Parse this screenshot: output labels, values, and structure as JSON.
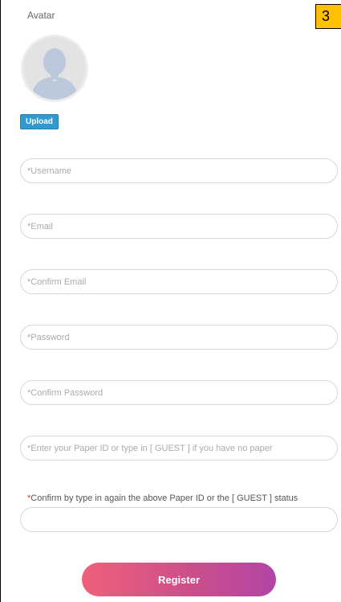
{
  "avatar": {
    "label": "Avatar",
    "image_icon": "user-silhouette-icon",
    "upload_label": "Upload"
  },
  "step_badge": {
    "text": "3"
  },
  "fields": {
    "username": {
      "placeholder": "*Username",
      "value": ""
    },
    "email": {
      "placeholder": "*Email",
      "value": ""
    },
    "confirm_email": {
      "placeholder": "*Confirm Email",
      "value": ""
    },
    "password": {
      "placeholder": "*Password",
      "value": ""
    },
    "confirm_password": {
      "placeholder": "*Confirm Password",
      "value": ""
    },
    "paper_id": {
      "placeholder": "*Enter your Paper ID or type in [ GUEST ] if you have no paper",
      "value": ""
    },
    "confirm_paper_id": {
      "label_star": "*",
      "label": "Confirm by type in again the above Paper ID or the [ GUEST ] status",
      "value": ""
    }
  },
  "register": {
    "label": "Register"
  },
  "colors": {
    "upload_button": "#2f9bd1",
    "register_gradient_start": "#f0607a",
    "register_gradient_end": "#b146a6",
    "badge": "#ffc000",
    "required_star": "#e0302f"
  }
}
